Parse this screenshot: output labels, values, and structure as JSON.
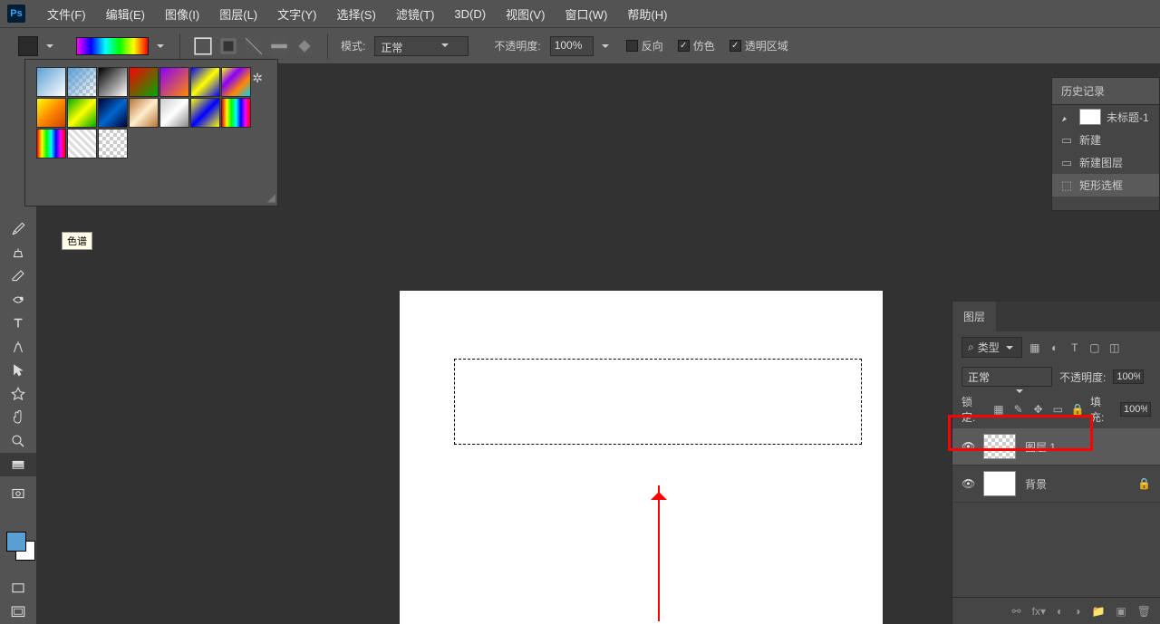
{
  "app": {
    "logo": "Ps"
  },
  "menubar": [
    "文件(F)",
    "编辑(E)",
    "图像(I)",
    "图层(L)",
    "文字(Y)",
    "选择(S)",
    "滤镜(T)",
    "3D(D)",
    "视图(V)",
    "窗口(W)",
    "帮助(H)"
  ],
  "options": {
    "mode_label": "模式:",
    "mode_value": "正常",
    "opacity_label": "不透明度:",
    "opacity_value": "100%",
    "reverse": "反向",
    "dither": "仿色",
    "transparency": "透明区域"
  },
  "gradient_tooltip": "色谱",
  "history": {
    "title": "历史记录",
    "doc": "未标题-1",
    "items": [
      "新建",
      "新建图层",
      "矩形选框"
    ]
  },
  "layers": {
    "title": "图层",
    "kind_label": "类型",
    "blend": "正常",
    "opacity_label": "不透明度:",
    "opacity_value": "100%",
    "lock_label": "锁定:",
    "fill_label": "填充:",
    "fill_value": "100%",
    "rows": [
      {
        "name": "图层 1",
        "transparent": true,
        "active": true
      },
      {
        "name": "背景",
        "transparent": false,
        "active": false
      }
    ]
  }
}
